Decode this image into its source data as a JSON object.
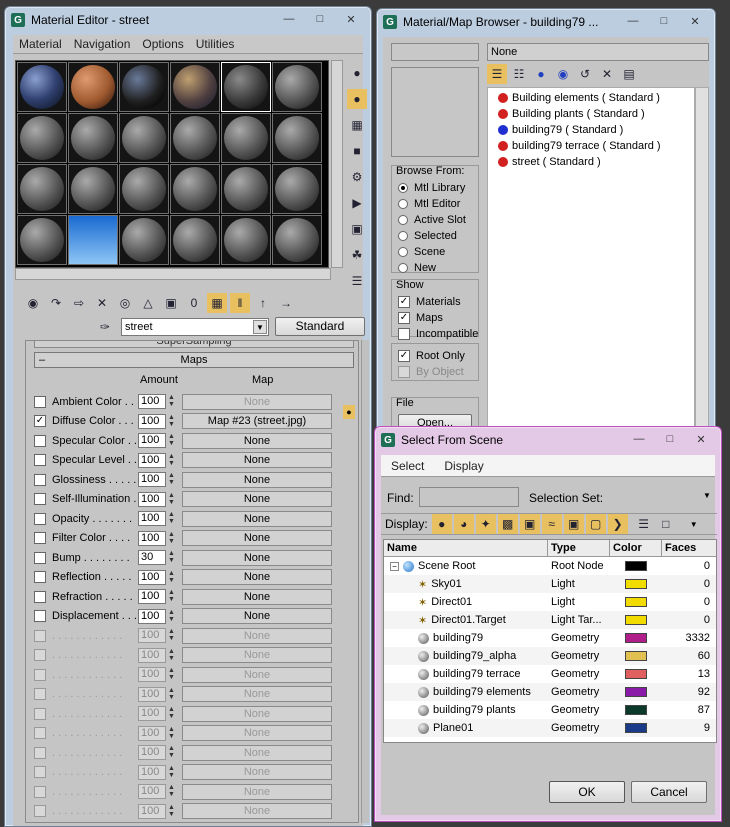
{
  "material_editor": {
    "title": "Material Editor - street",
    "menu": [
      "Material",
      "Navigation",
      "Options",
      "Utilities"
    ],
    "material_name": "street",
    "material_type": "Standard",
    "rollouts": {
      "supersampling": "SuperSampling",
      "maps": "Maps"
    },
    "maps_headers": {
      "amount": "Amount",
      "map": "Map"
    },
    "map_rows": [
      {
        "label": "Ambient Color . . .",
        "checked": false,
        "amount": "100",
        "map": "None",
        "disabled": false,
        "map_dim": true
      },
      {
        "label": "Diffuse Color . . .",
        "checked": true,
        "amount": "100",
        "map": "Map #23 (street.jpg)",
        "disabled": false
      },
      {
        "label": "Specular Color . .",
        "checked": false,
        "amount": "100",
        "map": "None",
        "disabled": false
      },
      {
        "label": "Specular Level . .",
        "checked": false,
        "amount": "100",
        "map": "None",
        "disabled": false
      },
      {
        "label": "Glossiness . . . . .",
        "checked": false,
        "amount": "100",
        "map": "None",
        "disabled": false
      },
      {
        "label": "Self-Illumination .",
        "checked": false,
        "amount": "100",
        "map": "None",
        "disabled": false
      },
      {
        "label": "Opacity . . . . . . .",
        "checked": false,
        "amount": "100",
        "map": "None",
        "disabled": false
      },
      {
        "label": "Filter Color . . . .",
        "checked": false,
        "amount": "100",
        "map": "None",
        "disabled": false
      },
      {
        "label": "Bump . . . . . . . .",
        "checked": false,
        "amount": "30",
        "map": "None",
        "disabled": false
      },
      {
        "label": "Reflection . . . . .",
        "checked": false,
        "amount": "100",
        "map": "None",
        "disabled": false
      },
      {
        "label": "Refraction . . . . .",
        "checked": false,
        "amount": "100",
        "map": "None",
        "disabled": false
      },
      {
        "label": "Displacement . . .",
        "checked": false,
        "amount": "100",
        "map": "None",
        "disabled": false
      },
      {
        "label": ". . . . . . . . . . . .",
        "checked": false,
        "amount": "100",
        "map": "None",
        "disabled": true
      },
      {
        "label": ". . . . . . . . . . . .",
        "checked": false,
        "amount": "100",
        "map": "None",
        "disabled": true
      },
      {
        "label": ". . . . . . . . . . . .",
        "checked": false,
        "amount": "100",
        "map": "None",
        "disabled": true
      },
      {
        "label": ". . . . . . . . . . . .",
        "checked": false,
        "amount": "100",
        "map": "None",
        "disabled": true
      },
      {
        "label": ". . . . . . . . . . . .",
        "checked": false,
        "amount": "100",
        "map": "None",
        "disabled": true
      },
      {
        "label": ". . . . . . . . . . . .",
        "checked": false,
        "amount": "100",
        "map": "None",
        "disabled": true
      },
      {
        "label": ". . . . . . . . . . . .",
        "checked": false,
        "amount": "100",
        "map": "None",
        "disabled": true
      },
      {
        "label": ". . . . . . . . . . . .",
        "checked": false,
        "amount": "100",
        "map": "None",
        "disabled": true
      },
      {
        "label": ". . . . . . . . . . . .",
        "checked": false,
        "amount": "100",
        "map": "None",
        "disabled": true
      },
      {
        "label": ". . . . . . . . . . . .",
        "checked": false,
        "amount": "100",
        "map": "None",
        "disabled": true
      },
      {
        "label": ". . . . . . . . . . . .",
        "checked": false,
        "amount": "100",
        "map": "None",
        "disabled": true
      }
    ]
  },
  "browser": {
    "title": "Material/Map Browser - building79 ...",
    "name_field": "None",
    "browse_from_title": "Browse From:",
    "browse_from": [
      "Mtl Library",
      "Mtl Editor",
      "Active Slot",
      "Selected",
      "Scene",
      "New"
    ],
    "browse_selected": 0,
    "show_title": "Show",
    "show": [
      {
        "label": "Materials",
        "checked": true
      },
      {
        "label": "Maps",
        "checked": true
      },
      {
        "label": "Incompatible",
        "checked": false
      }
    ],
    "root_only": "Root Only",
    "by_object": "By Object",
    "file_title": "File",
    "open_label": "Open...",
    "items": [
      "Building elements  ( Standard )",
      "Building plants  ( Standard )",
      "building79  ( Standard )",
      "building79 terrace  ( Standard )",
      "street  ( Standard )"
    ],
    "item_colors": [
      "#d02020",
      "#d02020",
      "#2030d0",
      "#d02020",
      "#d02020"
    ]
  },
  "select_scene": {
    "title": "Select From Scene",
    "menu": [
      "Select",
      "Display"
    ],
    "find_label": "Find:",
    "selection_set_label": "Selection Set:",
    "display_label": "Display:",
    "columns": [
      "Name",
      "Type",
      "Color",
      "Faces"
    ],
    "rows": [
      {
        "name": "Scene Root",
        "type": "Root Node",
        "color": "#000000",
        "faces": "0",
        "indent": 0,
        "icon": "globe"
      },
      {
        "name": "Sky01",
        "type": "Light",
        "color": "#f2dc00",
        "faces": "0",
        "indent": 1,
        "icon": "light"
      },
      {
        "name": "Direct01",
        "type": "Light",
        "color": "#f2dc00",
        "faces": "0",
        "indent": 1,
        "icon": "light"
      },
      {
        "name": "Direct01.Target",
        "type": "Light Tar...",
        "color": "#f2dc00",
        "faces": "0",
        "indent": 1,
        "icon": "light"
      },
      {
        "name": "building79",
        "type": "Geometry",
        "color": "#b01e8a",
        "faces": "3332",
        "indent": 1,
        "icon": "geo"
      },
      {
        "name": "building79_alpha",
        "type": "Geometry",
        "color": "#e0c050",
        "faces": "60",
        "indent": 1,
        "icon": "geo"
      },
      {
        "name": "building79 terrace",
        "type": "Geometry",
        "color": "#e06060",
        "faces": "13",
        "indent": 1,
        "icon": "geo"
      },
      {
        "name": "building79 elements",
        "type": "Geometry",
        "color": "#8a1aa8",
        "faces": "92",
        "indent": 1,
        "icon": "geo"
      },
      {
        "name": "building79 plants",
        "type": "Geometry",
        "color": "#0c3a2a",
        "faces": "87",
        "indent": 1,
        "icon": "geo"
      },
      {
        "name": "Plane01",
        "type": "Geometry",
        "color": "#1a3a8a",
        "faces": "9",
        "indent": 1,
        "icon": "geo"
      }
    ],
    "ok_label": "OK",
    "cancel_label": "Cancel"
  }
}
